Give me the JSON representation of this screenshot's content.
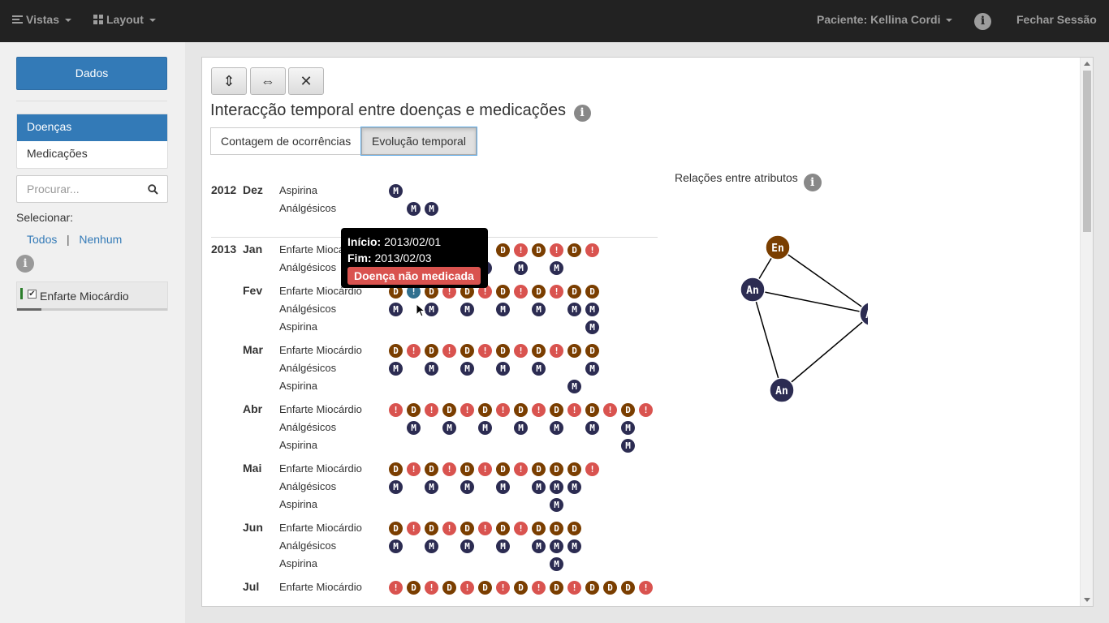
{
  "navbar": {
    "views_label": "Vistas",
    "layout_label": "Layout",
    "patient_label": "Paciente: Kellina Cordi",
    "info_icon": "i",
    "logout_label": "Fechar Sessão"
  },
  "sidebar": {
    "data_button": "Dados",
    "tabs": [
      {
        "label": "Doenças",
        "active": true
      },
      {
        "label": "Medicações",
        "active": false
      }
    ],
    "search": {
      "placeholder": "Procurar..."
    },
    "select_label": "Selecionar:",
    "select_all": "Todos",
    "select_sep": "|",
    "select_none": "Nenhum",
    "info_icon": "i",
    "filters": [
      {
        "label": "Enfarte Miocárdio",
        "checked": true,
        "checkmark": "✔"
      }
    ]
  },
  "panel": {
    "toolbar": {
      "vertical_icon": "⇕",
      "horizontal_icon": "⇔",
      "close_icon": "✕"
    },
    "title": "Interacção temporal entre doenças e medicações",
    "info_icon": "i",
    "tabs": [
      {
        "label": "Contagem de ocorrências",
        "active": false
      },
      {
        "label": "Evolução temporal",
        "active": true
      }
    ],
    "graph_title": "Relações entre atributos",
    "graph_info_icon": "i"
  },
  "timeline": [
    {
      "year": "2012",
      "month": "Dez",
      "rows": [
        {
          "label": "Aspirina",
          "marks": "M"
        },
        {
          "label": "Análgésicos",
          "marks": "_MM"
        }
      ]
    },
    {
      "year": "2013",
      "month": "Jan",
      "rows": [
        {
          "label": "Enfarte Miocárdio",
          "marks": "______DXDXDX"
        },
        {
          "label": "Análgésicos",
          "marks": "_____M_M_M"
        }
      ]
    },
    {
      "year": "",
      "month": "Fev",
      "rows": [
        {
          "label": "Enfarte Miocárdio",
          "marks": "DHDXDXDXDXDD"
        },
        {
          "label": "Análgésicos",
          "marks": "M_M_M_M_M_MM"
        },
        {
          "label": "Aspirina",
          "marks": "___________M"
        }
      ]
    },
    {
      "year": "",
      "month": "Mar",
      "rows": [
        {
          "label": "Enfarte Miocárdio",
          "marks": "DXDXDXDXDXDD"
        },
        {
          "label": "Análgésicos",
          "marks": "M_M_M_M_M__M"
        },
        {
          "label": "Aspirina",
          "marks": "__________M"
        }
      ]
    },
    {
      "year": "",
      "month": "Abr",
      "rows": [
        {
          "label": "Enfarte Miocárdio",
          "marks": "XDXDXDXDXDXDXDX"
        },
        {
          "label": "Análgésicos",
          "marks": "_M_M_M_M_M_M_M"
        },
        {
          "label": "Aspirina",
          "marks": "_____________M"
        }
      ]
    },
    {
      "year": "",
      "month": "Mai",
      "rows": [
        {
          "label": "Enfarte Miocárdio",
          "marks": "DXDXDXDXDDDX"
        },
        {
          "label": "Análgésicos",
          "marks": "M_M_M_M_MMM"
        },
        {
          "label": "Aspirina",
          "marks": "_________M"
        }
      ]
    },
    {
      "year": "",
      "month": "Jun",
      "rows": [
        {
          "label": "Enfarte Miocárdio",
          "marks": "DXDXDXDXDDD"
        },
        {
          "label": "Análgésicos",
          "marks": "M_M_M_M_MMM"
        },
        {
          "label": "Aspirina",
          "marks": "_________M"
        }
      ]
    },
    {
      "year": "",
      "month": "Jul",
      "rows": [
        {
          "label": "Enfarte Miocárdio",
          "marks": "XDXDXDXDXDXDDDX"
        }
      ]
    }
  ],
  "mark_glyphs": {
    "D": "D",
    "X": "!",
    "M": "M",
    "H": "!"
  },
  "tooltip": {
    "start_label": "Início:",
    "start_value": "2013/02/01",
    "end_label": "Fim:",
    "end_value": "2013/02/03",
    "badge": "Doença não medicada"
  },
  "graph": {
    "nodes": [
      {
        "id": "En",
        "label": "En",
        "color": "#7a3e00"
      },
      {
        "id": "An1",
        "label": "An",
        "color": "#2c2c52"
      },
      {
        "id": "As",
        "label": "As",
        "color": "#2c2c52"
      },
      {
        "id": "An2",
        "label": "An",
        "color": "#2c2c52"
      }
    ],
    "edges": [
      [
        "En",
        "An1"
      ],
      [
        "En",
        "As"
      ],
      [
        "An1",
        "As"
      ],
      [
        "An1",
        "An2"
      ],
      [
        "As",
        "An2"
      ]
    ]
  },
  "colors": {
    "disease": "#7a3e00",
    "unmedicated": "#d9534f",
    "medication": "#2c2c52",
    "highlight": "#31708f",
    "primary": "#337ab7"
  }
}
